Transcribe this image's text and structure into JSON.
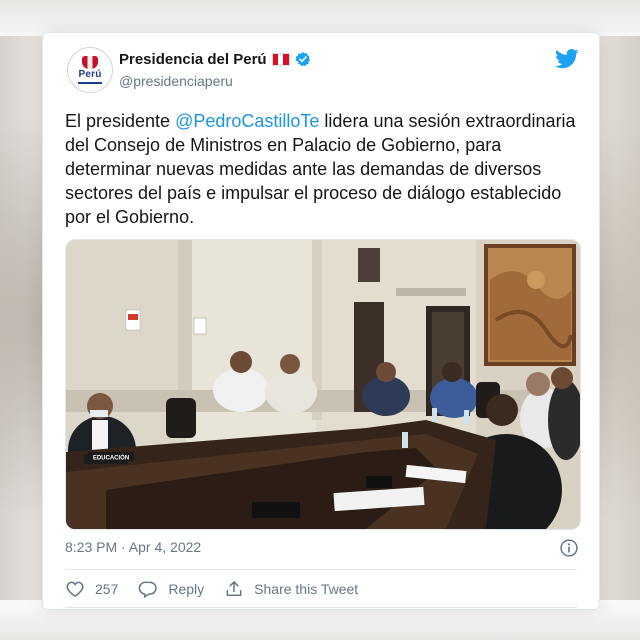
{
  "account": {
    "display_name": "Presidencia del Perú",
    "handle": "@presidenciaperu",
    "avatar_text": "Perú",
    "verified": true,
    "flag_icon": "peru-flag-icon",
    "colors": {
      "flag_red": "#d91023",
      "verified_blue": "#1da1f2"
    }
  },
  "tweet": {
    "text_before": "El presidente ",
    "mention": "@PedroCastilloTe",
    "text_after": " lidera una sesión extraordinaria del Consejo de Ministros en Palacio de Gobierno, para determinar nuevas medidas ante las demandas de diversos sectores del país e impulsar el proceso de diálogo establecido por el Gobierno.",
    "timestamp": "8:23 PM · Apr 4, 2022",
    "colors": {
      "link": "#1b95e0",
      "text": "#14171a",
      "muted": "#657786"
    }
  },
  "photo": {
    "name_plate": "EDUCACIÓN"
  },
  "actions": {
    "like_count": "257",
    "reply_label": "Reply",
    "share_label": "Share this Tweet"
  },
  "icons": [
    "twitter-bird-icon",
    "verified-badge-icon",
    "info-icon",
    "heart-icon",
    "reply-icon",
    "share-icon"
  ]
}
